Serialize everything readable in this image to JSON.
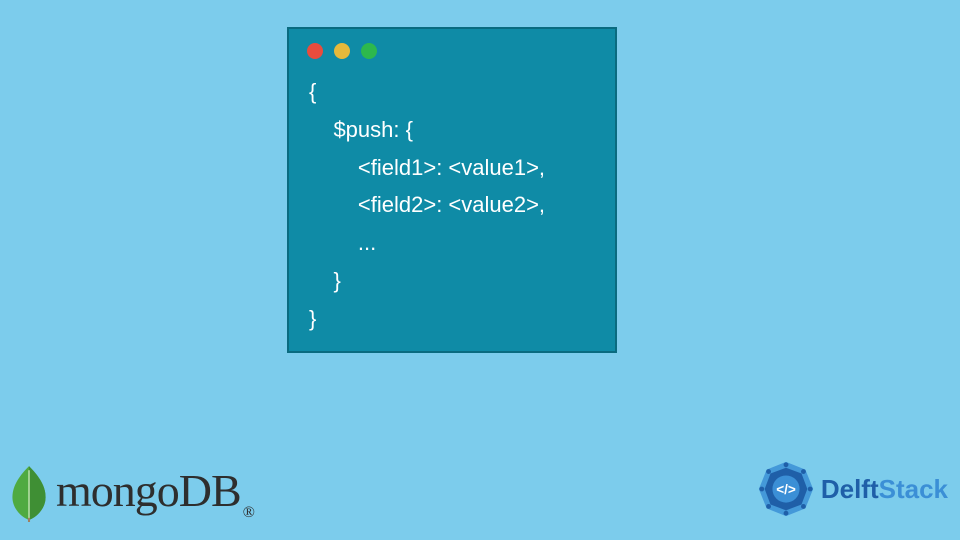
{
  "code": {
    "lines": [
      "{",
      "    $push: {",
      "        <field1>: <value1>,",
      "        <field2>: <value2>,",
      "        ...",
      "    }",
      "}"
    ],
    "window_buttons": [
      "red",
      "yellow",
      "green"
    ]
  },
  "brand_left": {
    "name": "mongoDB",
    "registered": "®",
    "icon": "leaf-icon",
    "color": "#4FAA41"
  },
  "brand_right": {
    "name_part1": "Delft",
    "name_part2": "Stack",
    "icon": "code-badge-icon",
    "colors": {
      "primary": "#1F5FA8",
      "secondary": "#3B8FD6"
    }
  }
}
